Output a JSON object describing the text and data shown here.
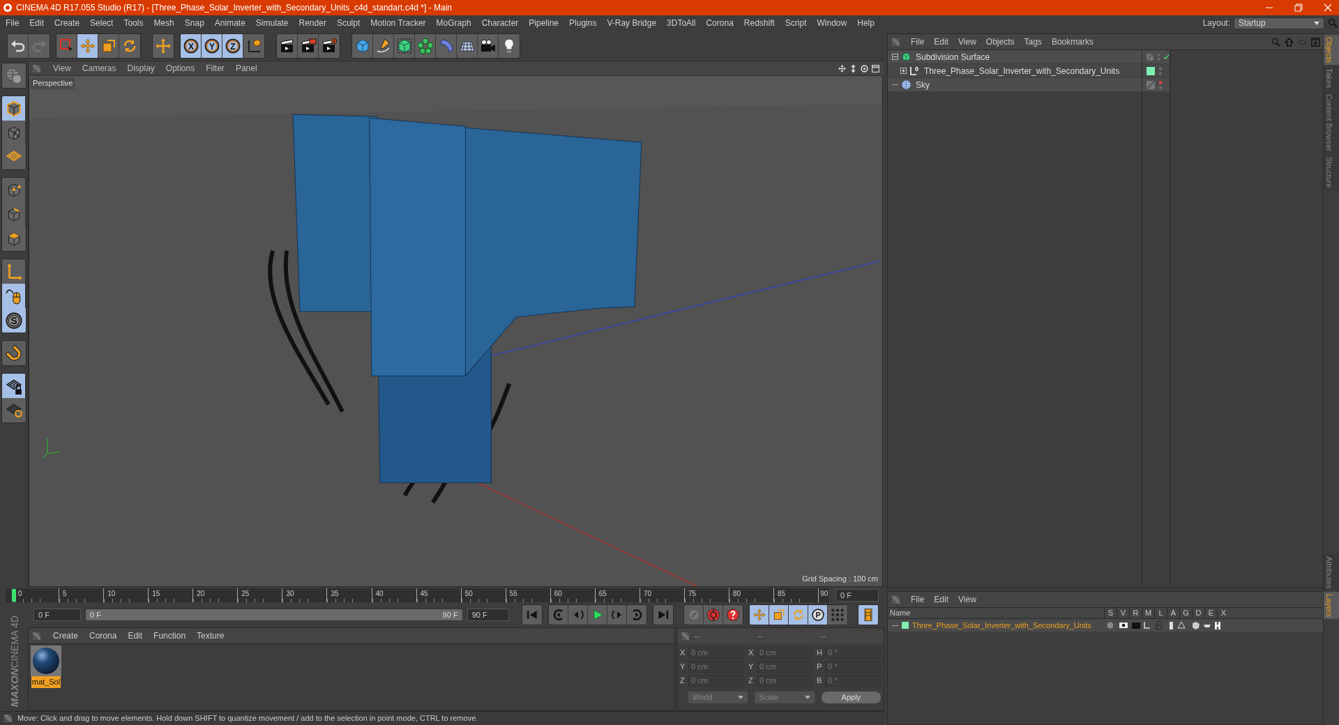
{
  "window": {
    "title": "CINEMA 4D R17.055 Studio (R17) - [Three_Phase_Solar_Inverter_with_Secondary_Units_c4d_standart.c4d *] - Main"
  },
  "menu": [
    "File",
    "Edit",
    "Create",
    "Select",
    "Tools",
    "Mesh",
    "Snap",
    "Animate",
    "Simulate",
    "Render",
    "Sculpt",
    "Motion Tracker",
    "MoGraph",
    "Character",
    "Pipeline",
    "Plugins",
    "V-Ray Bridge",
    "3DToAll",
    "Corona",
    "Redshift",
    "Script",
    "Window",
    "Help"
  ],
  "layout": {
    "label": "Layout:",
    "value": "Startup"
  },
  "toolbar": [
    [
      {
        "kind": "undo",
        "active": false
      },
      {
        "kind": "redo",
        "active": false
      }
    ],
    [
      {
        "kind": "select",
        "active": false
      },
      {
        "kind": "move",
        "active": true
      },
      {
        "kind": "scale",
        "active": false
      },
      {
        "kind": "rotate",
        "active": false
      }
    ],
    [
      {
        "kind": "transform",
        "active": false
      }
    ],
    [
      {
        "kind": "axis",
        "label": "X",
        "active": true
      },
      {
        "kind": "axis",
        "label": "Y",
        "active": true
      },
      {
        "kind": "axis",
        "label": "Z",
        "active": true
      },
      {
        "kind": "coord",
        "active": false
      }
    ],
    [
      {
        "kind": "render_view",
        "active": false
      },
      {
        "kind": "render_pv",
        "active": false
      },
      {
        "kind": "render_settings",
        "active": false
      }
    ],
    [
      {
        "kind": "cube",
        "active": false
      },
      {
        "kind": "pen",
        "active": false
      },
      {
        "kind": "subdiv",
        "active": false
      },
      {
        "kind": "cloner",
        "active": false
      },
      {
        "kind": "deformer",
        "active": false
      },
      {
        "kind": "floor",
        "active": false
      },
      {
        "kind": "camera",
        "active": false
      },
      {
        "kind": "light",
        "active": false
      }
    ]
  ],
  "left_tools": [
    [
      {
        "kind": "make_editable",
        "active": false
      }
    ],
    [
      {
        "kind": "model",
        "active": true
      },
      {
        "kind": "texture",
        "active": false
      },
      {
        "kind": "workplane",
        "active": false
      }
    ],
    [
      {
        "kind": "points",
        "active": false
      },
      {
        "kind": "edges",
        "active": false
      },
      {
        "kind": "polygons",
        "active": false
      }
    ],
    [
      {
        "kind": "axis_mode",
        "active": false
      },
      {
        "kind": "tweak",
        "active": true
      },
      {
        "kind": "snap",
        "label": "S",
        "active": true
      }
    ],
    [
      {
        "kind": "magnet",
        "active": false
      }
    ],
    [
      {
        "kind": "lock_workplane",
        "active": true
      },
      {
        "kind": "workplane_rotate",
        "active": false
      }
    ]
  ],
  "viewport": {
    "menu": [
      "View",
      "Cameras",
      "Display",
      "Options",
      "Filter",
      "Panel"
    ],
    "camera": "Perspective",
    "grid_spacing": "Grid Spacing : 100 cm"
  },
  "timeline": {
    "ticks": [
      "0",
      "5",
      "10",
      "15",
      "20",
      "25",
      "30",
      "35",
      "40",
      "45",
      "50",
      "55",
      "60",
      "65",
      "70",
      "75",
      "80",
      "85",
      "90"
    ],
    "playhead": {
      "level": 0
    },
    "current_frame": "0 F",
    "start": "0 F",
    "range_start": "0 F",
    "range_end": "90 F",
    "end": "90 F",
    "controls": [
      [
        {
          "kind": "to_start",
          "active": false
        }
      ],
      [
        {
          "kind": "prev_key",
          "active": false
        },
        {
          "kind": "prev_frame",
          "active": false
        },
        {
          "kind": "play",
          "active": false
        },
        {
          "kind": "next_frame",
          "active": false
        },
        {
          "kind": "next_key",
          "active": false
        }
      ],
      [
        {
          "kind": "to_end",
          "active": false
        }
      ],
      [
        {
          "kind": "record",
          "active": false
        },
        {
          "kind": "autokey",
          "active": false
        },
        {
          "kind": "keysel",
          "active": false
        }
      ],
      [
        {
          "kind": "key_move",
          "active": true
        },
        {
          "kind": "key_scale",
          "active": true
        },
        {
          "kind": "key_rotate",
          "active": true
        },
        {
          "kind": "key_param",
          "label": "P",
          "active": true
        },
        {
          "kind": "key_pla",
          "active": false
        }
      ],
      [
        {
          "kind": "timeline_window",
          "active": true
        }
      ]
    ]
  },
  "materials": {
    "menu": [
      "Create",
      "Corona",
      "Edit",
      "Function",
      "Texture"
    ],
    "items": [
      {
        "name": "mat_Sol",
        "selected": true
      }
    ]
  },
  "coordinates": {
    "headers": [
      "--",
      "--",
      "--"
    ],
    "rows": [
      [
        {
          "label": "X",
          "value": "0 cm"
        },
        {
          "label": "X",
          "value": "0 cm"
        },
        {
          "label": "H",
          "value": "0 °"
        }
      ],
      [
        {
          "label": "Y",
          "value": "0 cm"
        },
        {
          "label": "Y",
          "value": "0 cm"
        },
        {
          "label": "P",
          "value": "0 °"
        }
      ],
      [
        {
          "label": "Z",
          "value": "0 cm"
        },
        {
          "label": "Z",
          "value": "0 cm"
        },
        {
          "label": "B",
          "value": "0 °"
        }
      ]
    ],
    "mode": "World",
    "size_mode": "Scale",
    "apply": "Apply"
  },
  "status_bar": "Move: Click and drag to move elements. Hold down SHIFT to quantize movement / add to the selection in point mode, CTRL to remove.",
  "logo": {
    "brand": "MAXON",
    "product": "CINEMA 4D"
  },
  "objects": {
    "menu": [
      "File",
      "Edit",
      "View",
      "Objects",
      "Tags",
      "Bookmarks"
    ],
    "tree": [
      {
        "name": "Subdivision Surface",
        "kind": "subdiv",
        "expanded": true,
        "checkmark": true,
        "editor_hidden": false,
        "children": [
          {
            "name": "Three_Phase_Solar_Inverter_with_Secondary_Units",
            "kind": "null",
            "expanded": false,
            "badge": "0",
            "color": "#80f0b0",
            "checkmark": false,
            "editor_hidden": false
          }
        ]
      },
      {
        "name": "Sky",
        "kind": "sky",
        "checkmark": false,
        "editor_hidden": true
      }
    ]
  },
  "layers": {
    "menu": [
      "File",
      "Edit",
      "View"
    ],
    "columns": [
      "Name",
      "S",
      "V",
      "R",
      "M",
      "L",
      "A",
      "G",
      "D",
      "E",
      "X"
    ],
    "rows": [
      {
        "name": "Three_Phase_Solar_Inverter_with_Secondary_Units",
        "color": "#80f0b0"
      }
    ]
  },
  "side_tabs_top": [
    {
      "label": "Objects",
      "selected": true
    },
    {
      "label": "Takes",
      "selected": false
    },
    {
      "label": "Content Browser",
      "selected": false
    },
    {
      "label": "Structure",
      "selected": false
    }
  ],
  "side_tabs_bottom": [
    {
      "label": "Attributes",
      "selected": false
    },
    {
      "label": "Layers",
      "selected": true
    }
  ]
}
